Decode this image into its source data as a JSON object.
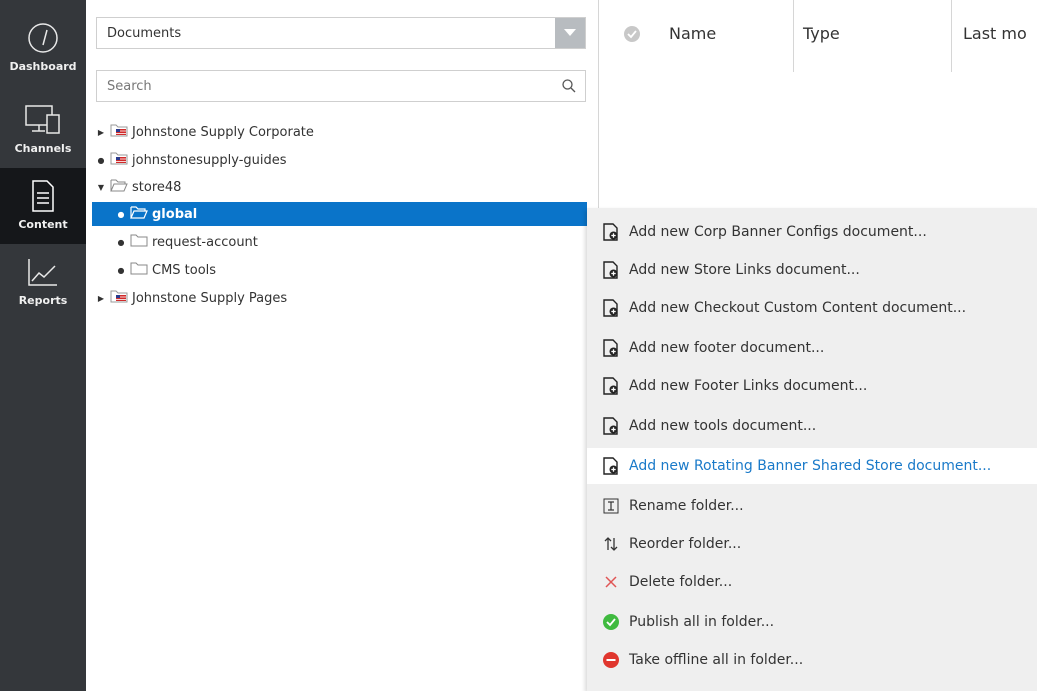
{
  "nav": {
    "items": [
      {
        "label": "Dashboard",
        "icon": "gauge-icon"
      },
      {
        "label": "Channels",
        "icon": "devices-icon"
      },
      {
        "label": "Content",
        "icon": "document-icon"
      },
      {
        "label": "Reports",
        "icon": "chart-line-icon"
      }
    ],
    "active": "Content"
  },
  "left_panel": {
    "select_value": "Documents",
    "search_placeholder": "Search"
  },
  "tree": [
    {
      "label": "Johnstone Supply Corporate",
      "toggle": "collapsed",
      "icon": "flag-folder-icon"
    },
    {
      "label": "johnstonesupply-guides",
      "toggle": "leaf",
      "icon": "flag-folder-icon"
    },
    {
      "label": "store48",
      "toggle": "expanded",
      "icon": "open-folder-icon"
    },
    {
      "label": "global",
      "toggle": "leaf",
      "icon": "open-folder-icon",
      "selected": true
    },
    {
      "label": "request-account",
      "toggle": "leaf",
      "icon": "folder-icon"
    },
    {
      "label": "CMS tools",
      "toggle": "leaf",
      "icon": "folder-icon"
    },
    {
      "label": "Johnstone Supply Pages",
      "toggle": "collapsed",
      "icon": "flag-folder-icon"
    }
  ],
  "table_header": {
    "columns": [
      "Name",
      "Type",
      "Last mo"
    ]
  },
  "context_menu": {
    "items": [
      {
        "label": "Add new Corp Banner Configs document...",
        "icon": "new-document-icon"
      },
      {
        "label": "Add new Store Links document...",
        "icon": "new-document-icon"
      },
      {
        "label": "Add new Checkout Custom Content document...",
        "icon": "new-document-icon"
      },
      {
        "label": "Add new footer document...",
        "icon": "new-document-icon"
      },
      {
        "label": "Add new Footer Links document...",
        "icon": "new-document-icon"
      },
      {
        "label": "Add new tools document...",
        "icon": "new-document-icon"
      },
      {
        "label": "Add new Rotating Banner Shared Store document...",
        "icon": "new-document-icon",
        "highlighted": true
      },
      {
        "label": "Rename folder...",
        "icon": "rename-icon"
      },
      {
        "label": "Reorder folder...",
        "icon": "reorder-icon"
      },
      {
        "label": "Delete folder...",
        "icon": "delete-icon"
      },
      {
        "label": "Publish all in folder...",
        "icon": "publish-icon"
      },
      {
        "label": "Take offline all in folder...",
        "icon": "take-offline-icon"
      }
    ]
  },
  "colors": {
    "nav_bg": "#34373b",
    "nav_active": "#15171a",
    "selection": "#0a74c9",
    "menu_bg": "#efefef",
    "highlight_text": "#1a7ac9",
    "publish_green": "#3fba3f",
    "offline_red": "#e0362e",
    "delete_red": "#e05555"
  }
}
